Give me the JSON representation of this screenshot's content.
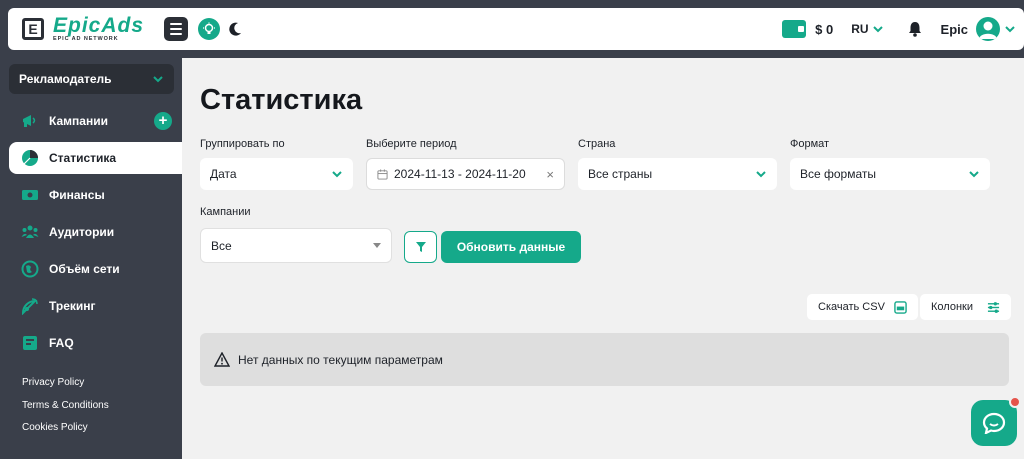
{
  "header": {
    "logo_letter": "E",
    "logo_title": "EpicAds",
    "logo_subtitle": "EPIC AD NETWORK",
    "balance": "$ 0",
    "language": "RU",
    "user_name": "Epic"
  },
  "sidebar": {
    "role": "Рекламодатель",
    "items": [
      {
        "label": "Кампании",
        "icon": "megaphone-icon"
      },
      {
        "label": "Статистика",
        "icon": "pie-chart-icon"
      },
      {
        "label": "Финансы",
        "icon": "money-icon"
      },
      {
        "label": "Аудитории",
        "icon": "users-icon"
      },
      {
        "label": "Объём сети",
        "icon": "globe-icon"
      },
      {
        "label": "Трекинг",
        "icon": "satellite-icon"
      },
      {
        "label": "FAQ",
        "icon": "book-icon"
      }
    ],
    "active_index": 1,
    "footer_links": [
      "Privacy Policy",
      "Terms & Conditions",
      "Cookies Policy"
    ]
  },
  "main": {
    "title": "Статистика",
    "filters": {
      "group_by_label": "Группировать по",
      "group_by_value": "Дата",
      "period_label": "Выберите период",
      "period_value": "2024-11-13 - 2024-11-20",
      "country_label": "Страна",
      "country_value": "Все страны",
      "format_label": "Формат",
      "format_value": "Все форматы",
      "campaigns_label": "Кампании",
      "campaigns_value": "Все"
    },
    "refresh_label": "Обновить данные",
    "csv_label": "Скачать CSV",
    "columns_label": "Колонки",
    "empty_message": "Нет данных по текущим параметрам"
  },
  "colors": {
    "accent": "#15a98a",
    "sidebar_bg": "#3a3f4a",
    "main_bg": "#f1f1f1",
    "notification": "#e5544b"
  }
}
